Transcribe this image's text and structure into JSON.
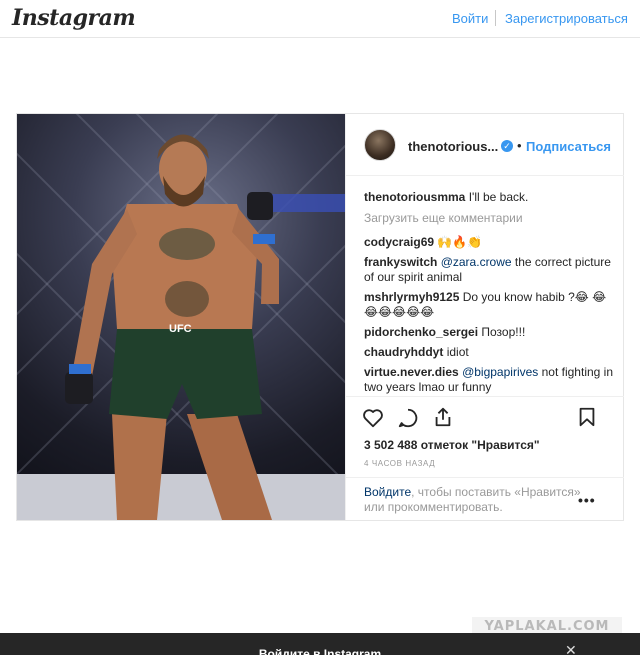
{
  "header": {
    "logo": "Instagram",
    "login": "Войти",
    "signup": "Зарегистрироваться"
  },
  "post": {
    "username_short": "thenotorious...",
    "follow": "Подписаться",
    "comments": [
      {
        "user": "thenotoriousmma",
        "text": "I'll be back."
      },
      {
        "load_more": "Загрузить еще комментарии"
      },
      {
        "user": "codycraig69",
        "text": "🙌🔥👏"
      },
      {
        "user": "frankyswitch",
        "mention": "@zara.crowe",
        "text": " the correct picture of our spirit animal"
      },
      {
        "user": "mshrlyrmyh9125",
        "text": "Do you know habib ?😂 😂😂😂😂😂😂"
      },
      {
        "user": "pidorchenko_sergei",
        "text": "Позор!!!"
      },
      {
        "user": "chaudryhddyt",
        "text": "idiot"
      },
      {
        "user": "virtue.never.dies",
        "mention": "@bigpapirives",
        "text": " not fighting in two years lmao ur funny"
      }
    ],
    "likes": "3 502 488 отметок \"Нравится\"",
    "time": "4 ЧАСОВ НАЗАД",
    "login_link": "Войдите",
    "login_rest": ", чтобы поставить «Нравится» или прокомментировать.",
    "more": "•••",
    "photo_text": "UFC"
  },
  "footer": {
    "banner": "Войдите в Instagram",
    "close": "✕"
  },
  "watermark": "YAPLAKAL.COM",
  "colors": {
    "accent": "#3897f0",
    "link_dark": "#003569",
    "text": "#262626",
    "muted": "#999999"
  },
  "icons": [
    "heart-icon",
    "comment-icon",
    "share-icon",
    "bookmark-icon",
    "verified-badge-icon",
    "close-icon"
  ]
}
